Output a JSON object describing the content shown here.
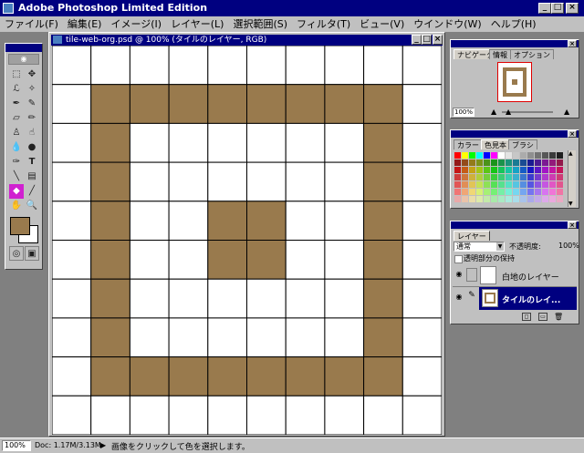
{
  "app": {
    "title": "Adobe Photoshop Limited Edition"
  },
  "menu": [
    "ファイル(F)",
    "編集(E)",
    "イメージ(I)",
    "レイヤー(L)",
    "選択範囲(S)",
    "フィルタ(T)",
    "ビュー(V)",
    "ウインドウ(W)",
    "ヘルプ(H)"
  ],
  "document": {
    "title": "tile-web-org.psd @ 100% (タイルのレイヤー, RGB)"
  },
  "navigator": {
    "tabs": [
      "ナビゲータ",
      "情報",
      "オプション"
    ],
    "zoom": "100%"
  },
  "color_panel": {
    "tabs": [
      "カラー",
      "色見本",
      "ブラシ"
    ]
  },
  "layers_panel": {
    "tab": "レイヤー",
    "blend_mode": "通常",
    "opacity_label": "不透明度:",
    "opacity_value": "100%",
    "preserve_label": "透明部分の保持",
    "layers": [
      {
        "name": "白地のレイヤー",
        "selected": false
      },
      {
        "name": "タイルのレイ...",
        "selected": true
      }
    ]
  },
  "status": {
    "zoom": "100%",
    "doc": "Doc: 1.17M/3.13M",
    "hint": "画像をクリックして色を選択します。"
  },
  "colors": {
    "brown": "#997a4d",
    "titlebar": "#000080",
    "face": "#c0c0c0"
  },
  "tile": {
    "rows": 10,
    "cols": 10,
    "brown": [
      [
        1,
        1
      ],
      [
        1,
        2
      ],
      [
        1,
        3
      ],
      [
        1,
        4
      ],
      [
        1,
        5
      ],
      [
        1,
        6
      ],
      [
        1,
        7
      ],
      [
        1,
        8
      ],
      [
        2,
        1
      ],
      [
        2,
        8
      ],
      [
        3,
        1
      ],
      [
        3,
        8
      ],
      [
        4,
        1
      ],
      [
        4,
        8
      ],
      [
        5,
        1
      ],
      [
        5,
        8
      ],
      [
        6,
        1
      ],
      [
        6,
        8
      ],
      [
        7,
        1
      ],
      [
        7,
        8
      ],
      [
        8,
        1
      ],
      [
        8,
        2
      ],
      [
        8,
        3
      ],
      [
        8,
        4
      ],
      [
        8,
        5
      ],
      [
        8,
        6
      ],
      [
        8,
        7
      ],
      [
        8,
        8
      ],
      [
        4,
        4
      ],
      [
        4,
        5
      ],
      [
        5,
        4
      ],
      [
        5,
        5
      ]
    ]
  }
}
